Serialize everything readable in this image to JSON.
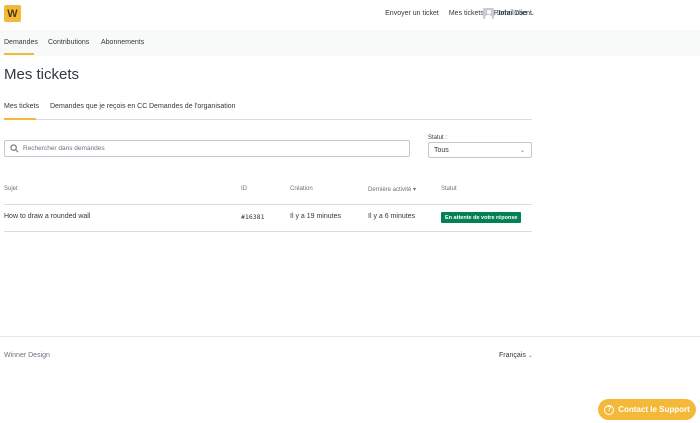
{
  "header": {
    "logo_letter": "W",
    "nav": [
      "Envoyer un ticket",
      "Mes tickets",
      "Portail client"
    ],
    "user_name": "John Doe"
  },
  "subnav": {
    "items": [
      "Demandes",
      "Contributions",
      "Abonnements"
    ],
    "active": "Demandes"
  },
  "page": {
    "title": "Mes tickets"
  },
  "tabs": {
    "items": [
      "Mes tickets",
      "Demandes que je reçois en CC",
      "Demandes de l'organisation"
    ],
    "active": "Mes tickets"
  },
  "filters": {
    "search_placeholder": "Rechercher dans demandes",
    "status_label": "Statut :",
    "status_value": "Tous"
  },
  "table": {
    "columns": [
      "Sujet",
      "ID",
      "Création",
      "Dernière activité ▾",
      "Statut"
    ],
    "rows": [
      {
        "subject": "How to draw a rounded wall",
        "id": "#16381",
        "created": "Il y a 19 minutes",
        "last_activity": "Il y a 6 minutes",
        "status": "En attente de votre réponse"
      }
    ]
  },
  "footer": {
    "brand": "Winner Design",
    "language": "Français"
  },
  "support": {
    "label": "Contact le Support"
  },
  "colors": {
    "accent": "#f5b93a",
    "status_green": "#038153"
  }
}
